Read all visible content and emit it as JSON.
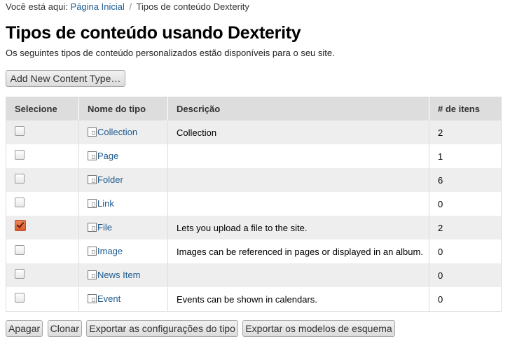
{
  "breadcrumb": {
    "prefix": "Você está aqui:",
    "home": "Página Inicial",
    "separator": "/",
    "current": "Tipos de conteúdo Dexterity"
  },
  "page": {
    "title": "Tipos de conteúdo usando Dexterity",
    "description": "Os seguintes tipos de conteúdo personalizados estão disponíveis para o seu site.",
    "add_button": "Add New Content Type…"
  },
  "table": {
    "headers": {
      "select": "Selecione",
      "name": "Nome do tipo",
      "description": "Descrição",
      "count": "# de itens"
    },
    "rows": [
      {
        "name": "Collection",
        "description": "Collection",
        "count": "2",
        "checked": false
      },
      {
        "name": "Page",
        "description": "",
        "count": "1",
        "checked": false
      },
      {
        "name": "Folder",
        "description": "",
        "count": "6",
        "checked": false
      },
      {
        "name": "Link",
        "description": "",
        "count": "0",
        "checked": false
      },
      {
        "name": "File",
        "description": "Lets you upload a file to the site.",
        "count": "2",
        "checked": true
      },
      {
        "name": "Image",
        "description": "Images can be referenced in pages or displayed in an album.",
        "count": "0",
        "checked": false
      },
      {
        "name": "News Item",
        "description": "",
        "count": "0",
        "checked": false
      },
      {
        "name": "Event",
        "description": "Events can be shown in calendars.",
        "count": "0",
        "checked": false
      }
    ]
  },
  "actions": {
    "delete": "Apagar",
    "clone": "Clonar",
    "export_types": "Exportar as configurações do tipo",
    "export_schemas": "Exportar os modelos de esquema"
  },
  "colors": {
    "link": "#205c90",
    "header_bg": "#dddddd",
    "stripe_bg": "#eeeeee",
    "checkbox_checked": "#e06a3c"
  }
}
